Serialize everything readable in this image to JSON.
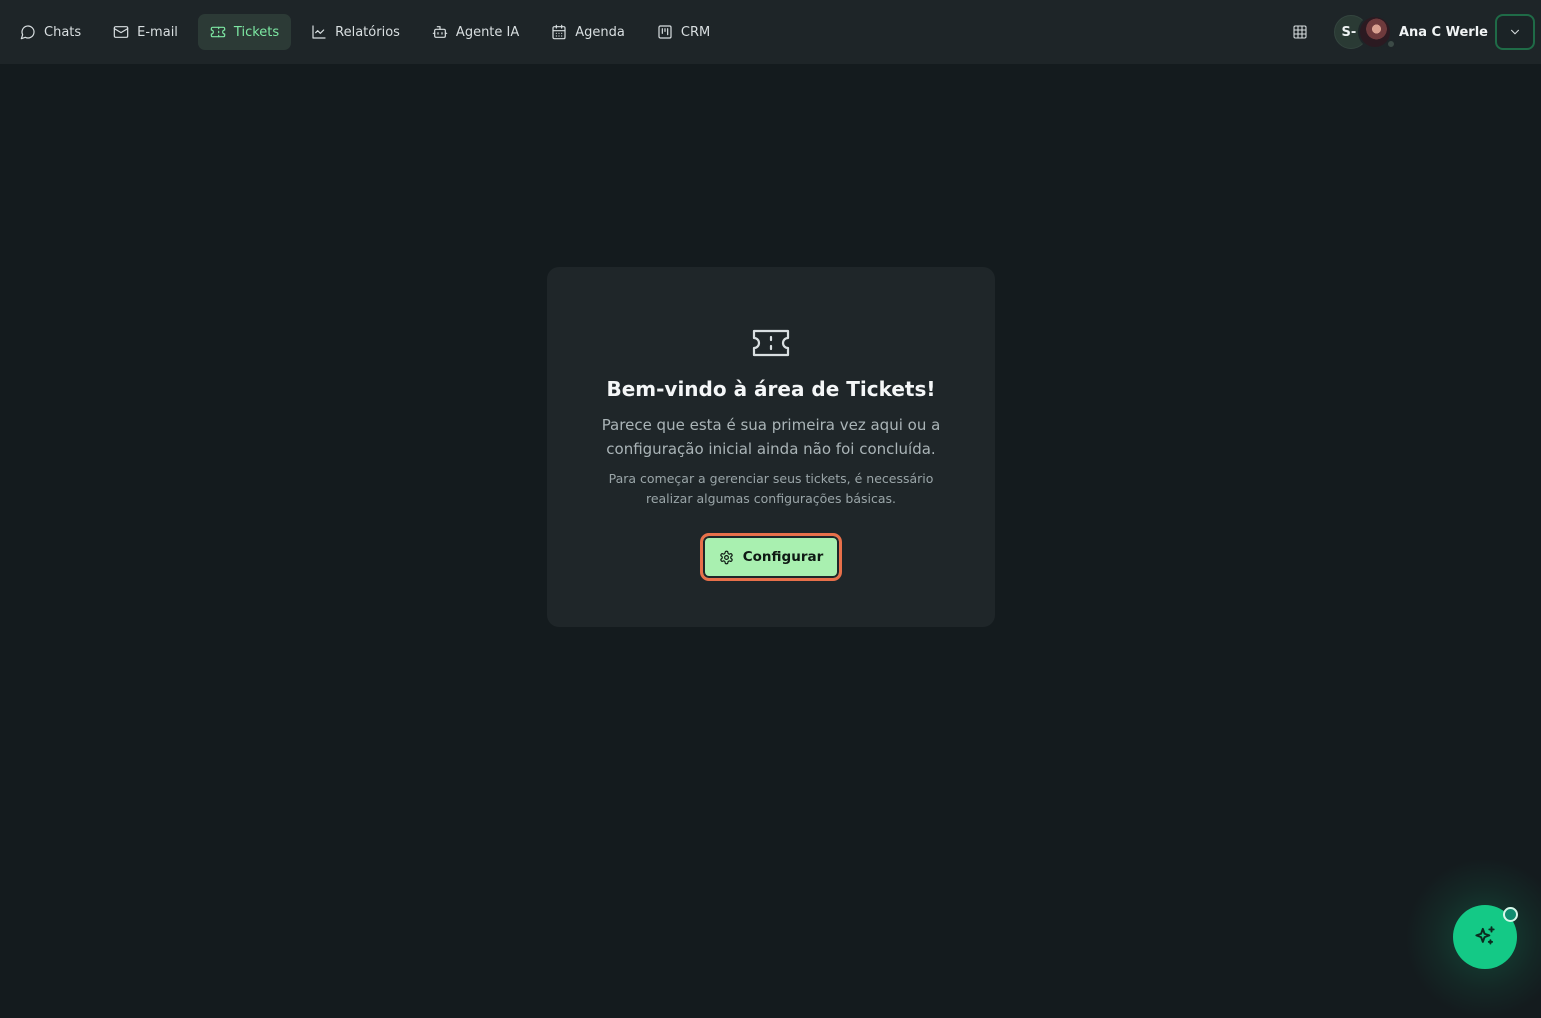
{
  "nav": {
    "items": [
      {
        "label": "Chats",
        "icon": "chat-bubble-icon"
      },
      {
        "label": "E-mail",
        "icon": "mail-icon"
      },
      {
        "label": "Tickets",
        "icon": "ticket-icon",
        "active": true
      },
      {
        "label": "Relatórios",
        "icon": "line-chart-icon"
      },
      {
        "label": "Agente IA",
        "icon": "robot-icon"
      },
      {
        "label": "Agenda",
        "icon": "calendar-icon"
      },
      {
        "label": "CRM",
        "icon": "kanban-icon"
      }
    ]
  },
  "user": {
    "initial": "S-",
    "name": "Ana C Werle"
  },
  "card": {
    "title": "Bem-vindo à área de Tickets!",
    "description": "Parece que esta é sua primeira vez aqui ou a configuração inicial ainda não foi concluída.",
    "note": "Para começar a gerenciar seus tickets, é necessário realizar algumas configurações básicas.",
    "button_label": "Configurar"
  },
  "colors": {
    "background": "#141b1e",
    "topbar": "#1e2528",
    "active_accent": "#7de8a3",
    "button_fill": "#a9f0b0",
    "button_focus_ring": "#e8704a",
    "fab": "#14c986"
  }
}
